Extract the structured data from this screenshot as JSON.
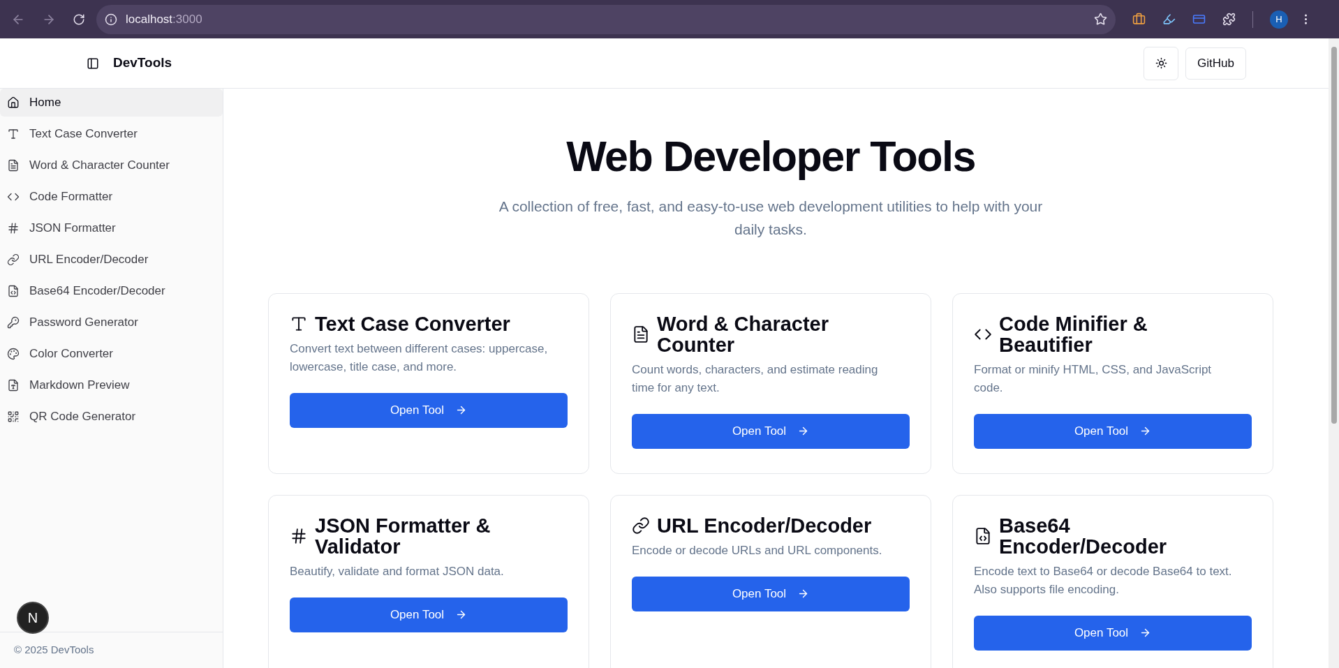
{
  "browser": {
    "address_host": "localhost",
    "address_port": ":3000",
    "profile_initial": "H"
  },
  "header": {
    "brand": "DevTools",
    "github_label": "GitHub"
  },
  "sidebar": {
    "items": [
      {
        "label": "Home",
        "kind": "home",
        "selected": true
      },
      {
        "label": "Text Case Converter",
        "kind": "type",
        "selected": false
      },
      {
        "label": "Word & Character Counter",
        "kind": "counter",
        "selected": false
      },
      {
        "label": "Code Formatter",
        "kind": "code",
        "selected": false
      },
      {
        "label": "JSON Formatter",
        "kind": "json",
        "selected": false
      },
      {
        "label": "URL Encoder/Decoder",
        "kind": "url",
        "selected": false
      },
      {
        "label": "Base64 Encoder/Decoder",
        "kind": "base64",
        "selected": false
      },
      {
        "label": "Password Generator",
        "kind": "password",
        "selected": false
      },
      {
        "label": "Color Converter",
        "kind": "color",
        "selected": false
      },
      {
        "label": "Markdown Preview",
        "kind": "markdown",
        "selected": false
      },
      {
        "label": "QR Code Generator",
        "kind": "qr",
        "selected": false
      }
    ],
    "footer": "© 2025 DevTools"
  },
  "hero": {
    "title": "Web Developer Tools",
    "subtitle": "A collection of free, fast, and easy-to-use web development utilities to help with your daily tasks."
  },
  "cards": [
    {
      "kind": "type",
      "title": "Text Case Converter",
      "description": "Convert text between different cases: uppercase, lowercase, title case, and more.",
      "button": "Open Tool"
    },
    {
      "kind": "counter",
      "title": "Word & Character Counter",
      "description": "Count words, characters, and estimate reading time for any text.",
      "button": "Open Tool"
    },
    {
      "kind": "code",
      "title": "Code Minifier & Beautifier",
      "description": "Format or minify HTML, CSS, and JavaScript code.",
      "button": "Open Tool"
    },
    {
      "kind": "json",
      "title": "JSON Formatter & Validator",
      "description": "Beautify, validate and format JSON data.",
      "button": "Open Tool"
    },
    {
      "kind": "url",
      "title": "URL Encoder/Decoder",
      "description": "Encode or decode URLs and URL components.",
      "button": "Open Tool"
    },
    {
      "kind": "base64",
      "title": "Base64 Encoder/Decoder",
      "description": "Encode text to Base64 or decode Base64 to text. Also supports file encoding.",
      "button": "Open Tool"
    }
  ],
  "dev_badge": "N"
}
